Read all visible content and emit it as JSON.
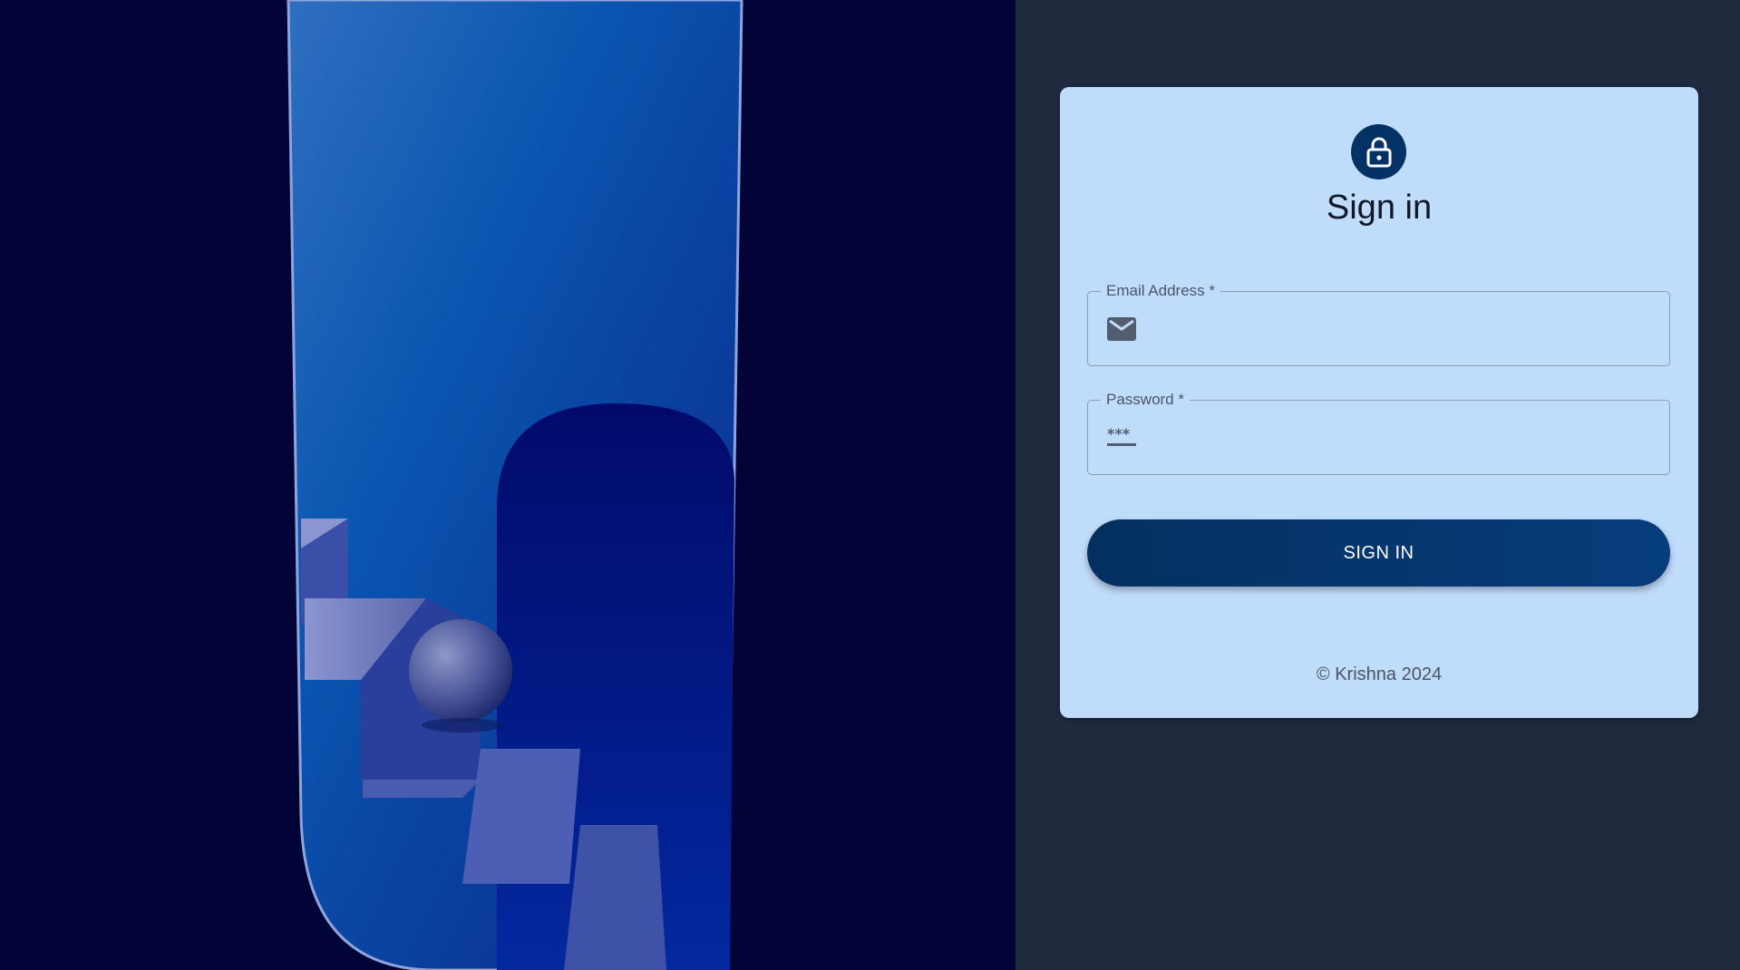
{
  "hero": {
    "icon": "abstract-stairs-arch-illustration"
  },
  "signin": {
    "lock_icon": "lock-icon",
    "title": "Sign in",
    "email": {
      "label": "Email Address *",
      "icon": "email-icon",
      "value": ""
    },
    "password": {
      "label": "Password *",
      "icon": "password-icon",
      "value": ""
    },
    "button_label": "SIGN IN",
    "footer": "© Krishna 2024"
  },
  "colors": {
    "hero_background": "#020336",
    "right_background": "#1f2a3e",
    "card_background": "#c0dcfb",
    "accent": "#053264"
  }
}
